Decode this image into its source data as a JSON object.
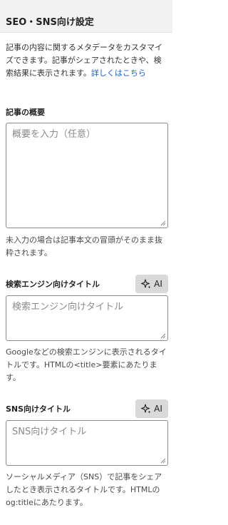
{
  "header": {
    "title": "SEO・SNS向け設定"
  },
  "intro": {
    "text": "記事の内容に関するメタデータをカスタマイズできます。記事がシェアされたときや、検索結果に表示されます。",
    "link": "詳しくはこちら"
  },
  "summary": {
    "label": "記事の概要",
    "placeholder": "概要を入力（任意）",
    "help": "未入力の場合は記事本文の冒頭がそのまま抜粋されます。"
  },
  "search_title": {
    "label": "検索エンジン向けタイトル",
    "ai_label": "AI",
    "placeholder": "検索エンジン向けタイトル",
    "help": "Googleなどの検索エンジンに表示されるタイトルです。HTMLの<title>要素にあたります。"
  },
  "sns_title": {
    "label": "SNS向けタイトル",
    "ai_label": "AI",
    "placeholder": "SNS向けタイトル",
    "help": "ソーシャルメディア（SNS）で記事をシェアしたとき表示されるタイトルです。HTMLのog:titleにあたります。"
  },
  "colors": {
    "link": "#1a5fd0",
    "header_bg": "#f2f2f2",
    "ai_bg": "#d9d9d9"
  },
  "icons": {
    "ai": "sparkle-icon",
    "resize": "resize-grip-icon"
  }
}
